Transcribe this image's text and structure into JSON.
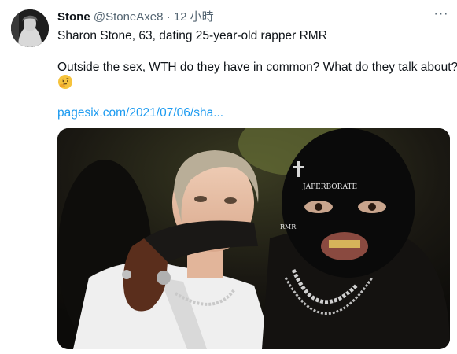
{
  "tweet": {
    "display_name": "Stone",
    "handle": "@StoneAxe8",
    "separator": "·",
    "time": "12 小時",
    "more_label": "···",
    "line1": "Sharon Stone, 63, dating 25-year-old rapper RMR",
    "line2": "Outside the sex, WTH do they have in common? What do they talk about?",
    "emoji": "thinking-face-emoji",
    "link": "pagesix.com/2021/07/06/sha..."
  },
  "photo": {
    "mask_text": "JAPERBORATE",
    "chain_text": "RMR"
  },
  "colors": {
    "link": "#1d9bf0",
    "secondary_text": "#536471",
    "primary_text": "#0f1419"
  }
}
